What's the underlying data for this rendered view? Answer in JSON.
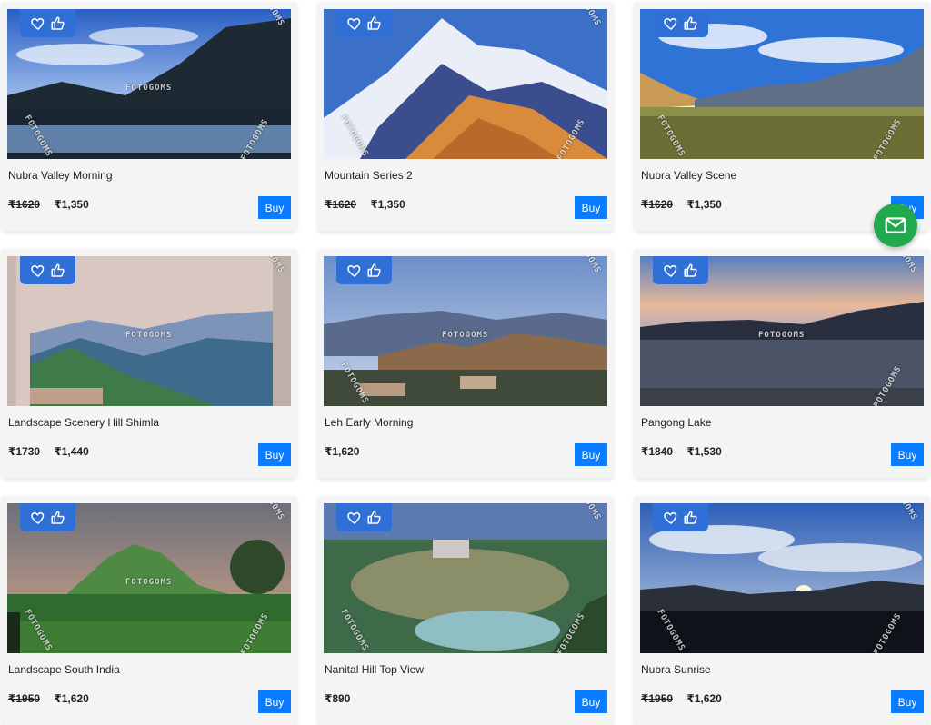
{
  "products": [
    {
      "title": "Nubra Valley Morning",
      "old_price": "₹1620",
      "price": "₹1,350",
      "buy": "Buy",
      "watermark": "FOTOGOMS"
    },
    {
      "title": "Mountain Series 2",
      "old_price": "₹1620",
      "price": "₹1,350",
      "buy": "Buy",
      "watermark": "FOTOGOMS"
    },
    {
      "title": "Nubra Valley Scene",
      "old_price": "₹1620",
      "price": "₹1,350",
      "buy": "Buy",
      "watermark": "FOTOGOMS"
    },
    {
      "title": "Landscape Scenery Hill Shimla",
      "old_price": "₹1730",
      "price": "₹1,440",
      "buy": "Buy",
      "watermark": "FOTOGOMS"
    },
    {
      "title": "Leh Early Morning",
      "old_price": "",
      "price": "₹1,620",
      "buy": "Buy",
      "watermark": "FOTOGOMS"
    },
    {
      "title": "Pangong Lake",
      "old_price": "₹1840",
      "price": "₹1,530",
      "buy": "Buy",
      "watermark": "FOTOGOMS"
    },
    {
      "title": "Landscape South India",
      "old_price": "₹1950",
      "price": "₹1,620",
      "buy": "Buy",
      "watermark": "FOTOGOMS"
    },
    {
      "title": "Nanital Hill Top View",
      "old_price": "",
      "price": "₹890",
      "buy": "Buy",
      "watermark": "FOTOGOMS"
    },
    {
      "title": "Nubra Sunrise",
      "old_price": "₹1950",
      "price": "₹1,620",
      "buy": "Buy",
      "watermark": "FOTOGOMS"
    }
  ],
  "icons": {
    "wishlist": "heart-icon",
    "like": "thumbs-up-icon",
    "contact": "mail-icon"
  },
  "colors": {
    "accent": "#0a7cff",
    "actions_bg": "#2f6fd6",
    "fab": "#21a94f"
  }
}
